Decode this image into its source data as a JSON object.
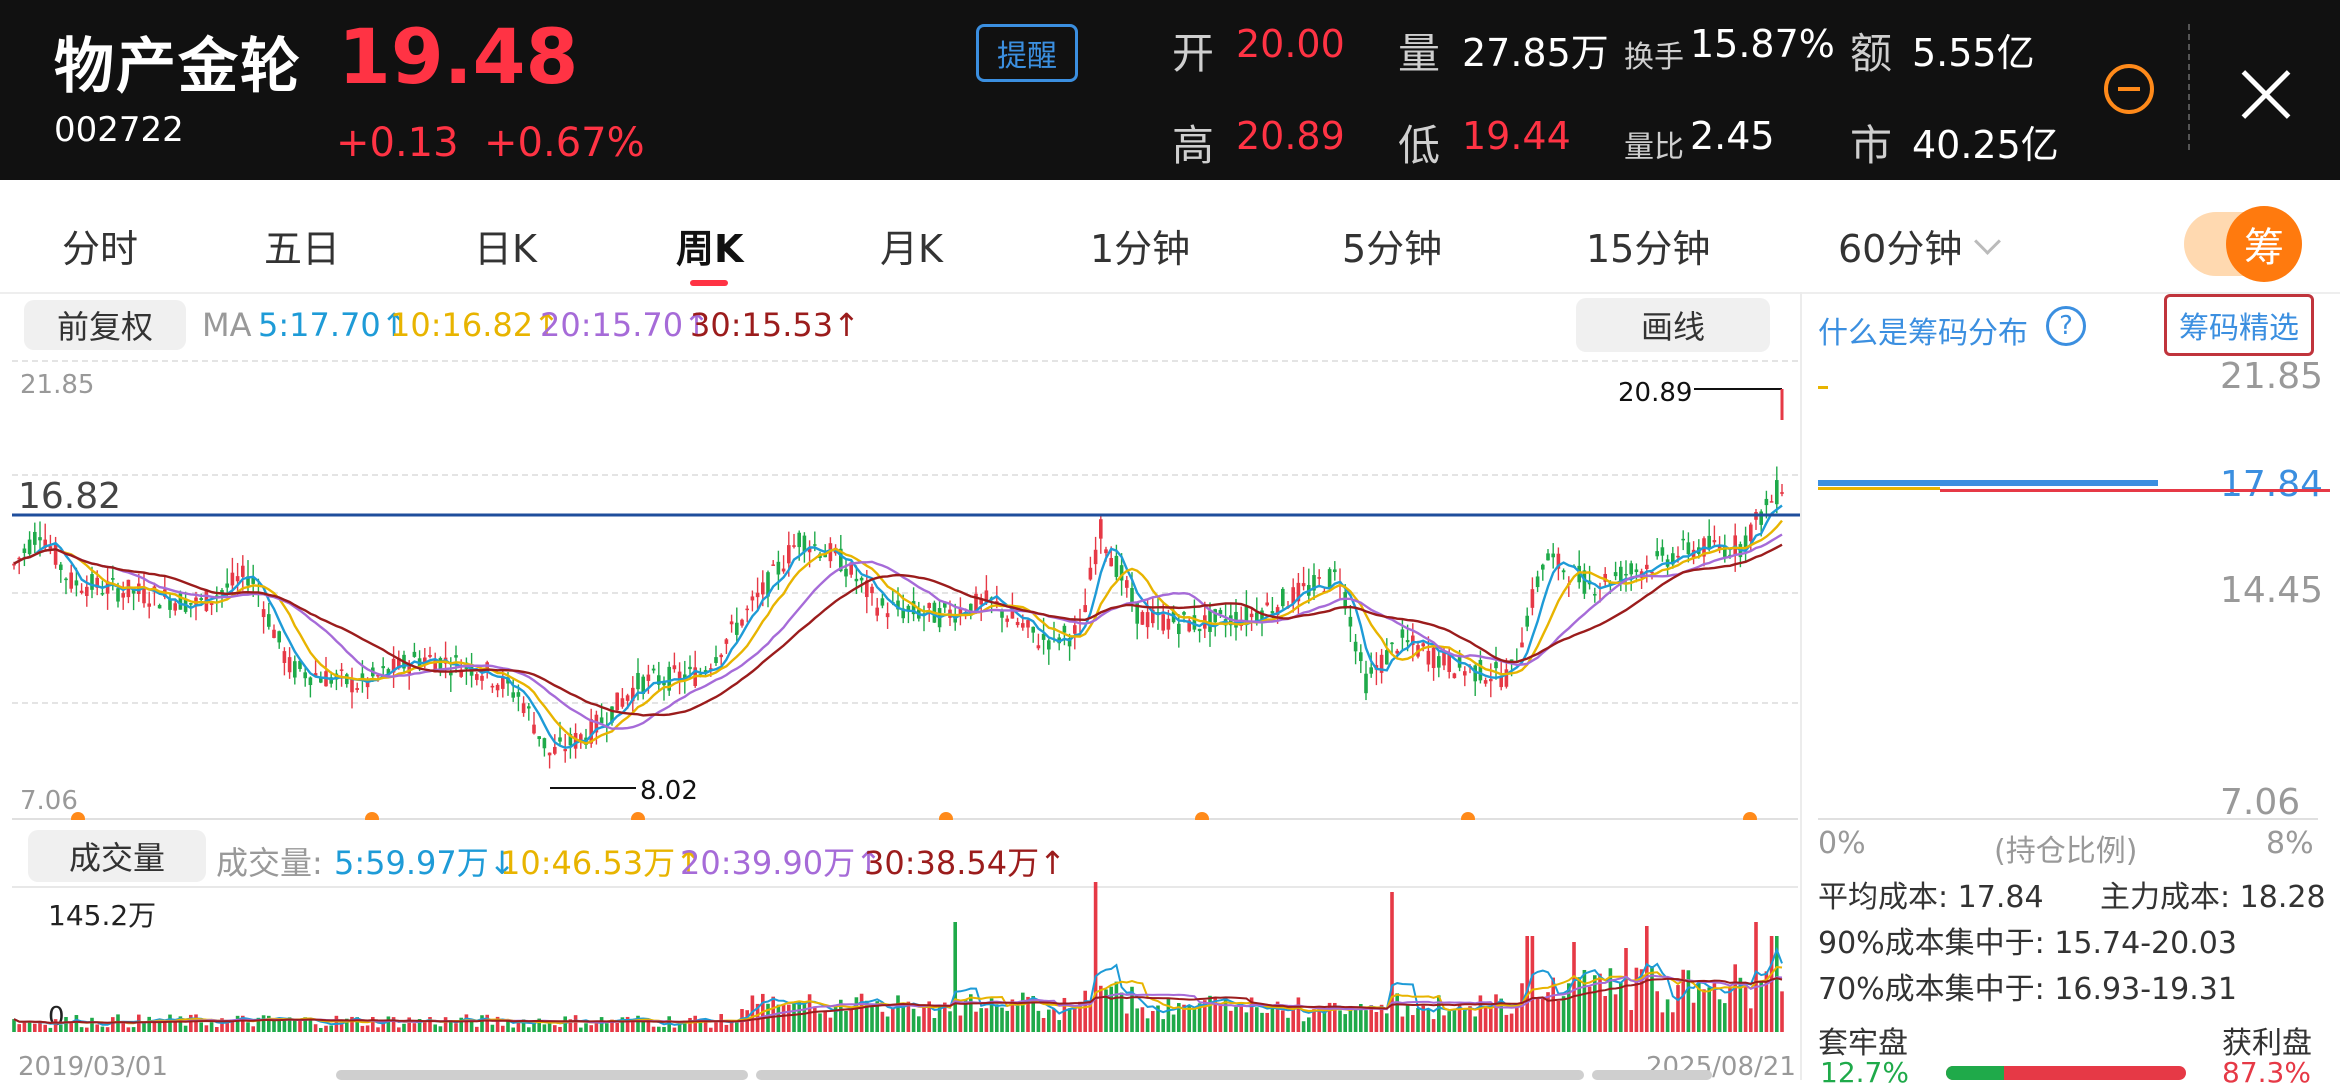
{
  "header": {
    "name": "物产金轮",
    "code": "002722",
    "price": "19.48",
    "change": "+0.13",
    "change_pct": "+0.67%",
    "remind": "提醒",
    "open_label": "开",
    "open": "20.00",
    "high_label": "高",
    "high": "20.89",
    "vol_label": "量",
    "vol": "27.85万",
    "low_label": "低",
    "low": "19.44",
    "turnover_label": "换手",
    "turnover": "15.87%",
    "vol_ratio_label": "量比",
    "vol_ratio": "2.45",
    "amount_label": "额",
    "amount": "5.55亿",
    "mcap_label": "市",
    "mcap": "40.25亿"
  },
  "tabs": [
    "分时",
    "五日",
    "日K",
    "周K",
    "月K",
    "1分钟",
    "5分钟",
    "15分钟",
    "60分钟"
  ],
  "active_tab": "周K",
  "toggle_label": "筹",
  "toolbar": {
    "adjust": "前复权",
    "ma_label": "MA",
    "ma5": "5:17.70↑",
    "ma10": "10:16.82↑",
    "ma20": "20:15.70↑",
    "ma30": "30:15.53↑",
    "draw": "画线"
  },
  "price_axis": {
    "top": "21.85",
    "bottom": "7.06",
    "line_label": "16.82",
    "max_label": "20.89",
    "min_label": "8.02"
  },
  "volume": {
    "button": "成交量",
    "label": "成交量:",
    "ma5": "5:59.97万↓",
    "ma10": "10:46.53万↑",
    "ma20": "20:39.90万↑",
    "ma30": "30:38.54万↑",
    "max": "145.2万",
    "zero": "0"
  },
  "dates": {
    "start": "2019/03/01",
    "end": "2025/08/21"
  },
  "chip": {
    "what": "什么是筹码分布",
    "help": "?",
    "select": "筹码精选",
    "y_top": "21.85",
    "y_mid_red": "17.84",
    "y_mid": "14.45",
    "y_bottom": "7.06",
    "x_left": "0%",
    "x_mid": "(持仓比例)",
    "x_right": "8%",
    "avg_cost_label": "平均成本:",
    "avg_cost": "17.84",
    "main_cost_label": "主力成本:",
    "main_cost": "18.28",
    "c90_label": "90%成本集中于:",
    "c90": "15.74-20.03",
    "c70_label": "70%成本集中于:",
    "c70": "16.93-19.31",
    "trapped_label": "套牢盘",
    "trapped": "12.7%",
    "profit_label": "获利盘",
    "profit": "87.3%"
  },
  "colors": {
    "up": "#e63946",
    "down": "#1faa4a",
    "ma5": "#1e9bd7",
    "ma10": "#e8b400",
    "ma20": "#a66bd8",
    "ma30": "#9b1c1c",
    "hline": "#1f4e9c"
  },
  "chart_data": {
    "type": "candlestick",
    "period": "weekly",
    "ylim": [
      7.06,
      21.85
    ],
    "period_high": 20.89,
    "period_low": 8.02,
    "reference_line": 16.82,
    "x_range": [
      "2019/03/01",
      "2025/08/21"
    ],
    "volume_max": "145.2万",
    "ma": {
      "5": 17.7,
      "10": 16.82,
      "20": 15.7,
      "30": 15.53
    }
  }
}
